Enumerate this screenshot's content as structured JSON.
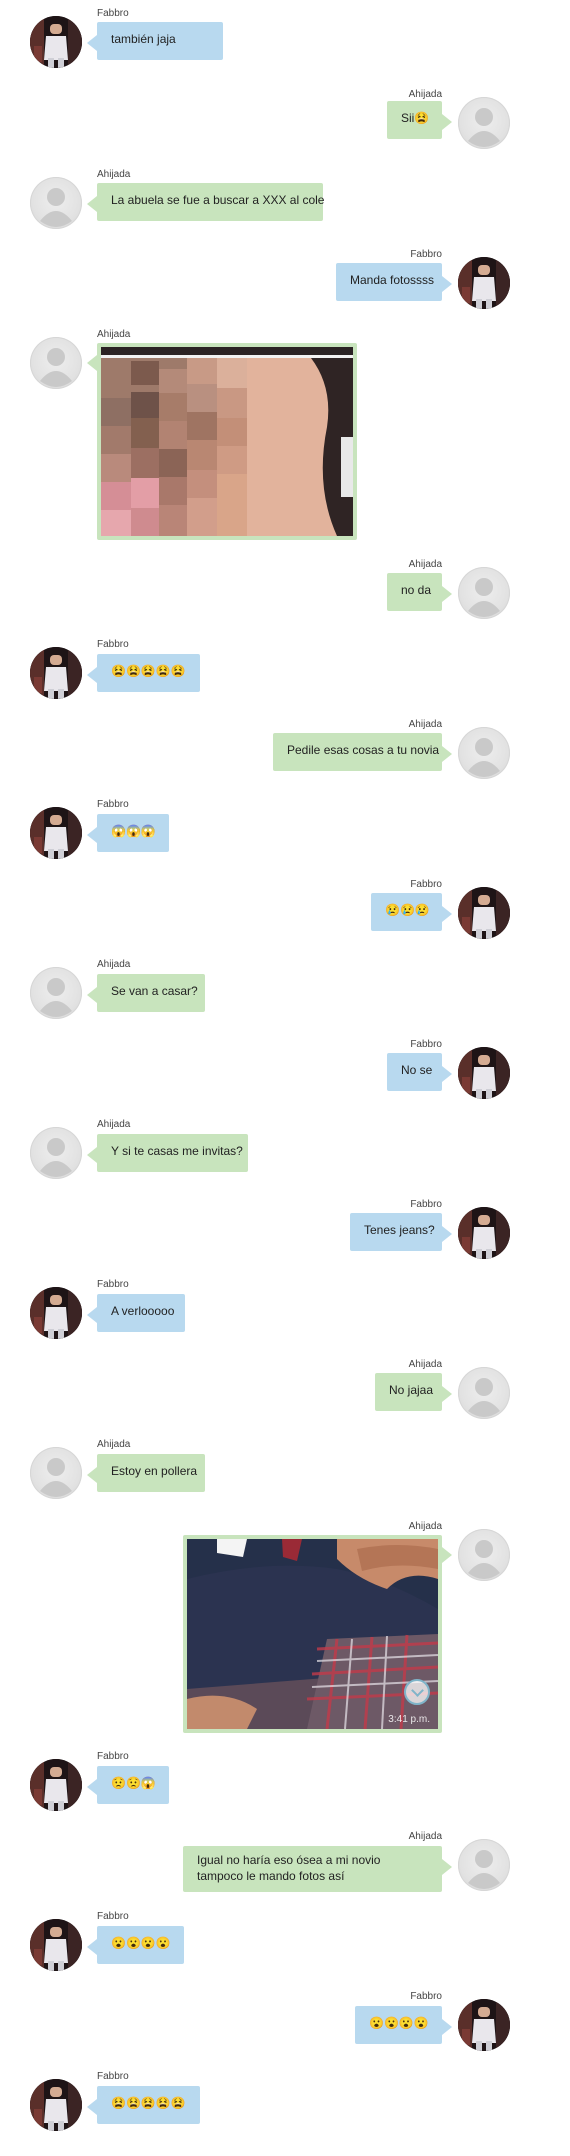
{
  "participants": {
    "fabbro": "Fabbro",
    "ahijada": "Ahijada"
  },
  "colors": {
    "fabbro_bubble": "#b8d9ef",
    "ahijada_bubble": "#c8e4bd",
    "background": "#ffffff"
  },
  "messages": [
    {
      "side": "left",
      "sender": "Fabbro",
      "text": "también jaja",
      "type": "text"
    },
    {
      "side": "right",
      "sender": "Ahijada",
      "text": "Sii😫",
      "type": "text"
    },
    {
      "side": "left",
      "sender": "Ahijada",
      "text": "La abuela se fue a buscar a XXX al cole",
      "type": "text"
    },
    {
      "side": "right",
      "sender": "Fabbro",
      "text": "Manda fotossss",
      "type": "text"
    },
    {
      "side": "left",
      "sender": "Ahijada",
      "text": "",
      "type": "image",
      "image": "pixelated-photo"
    },
    {
      "side": "right",
      "sender": "Ahijada",
      "text": "no da",
      "type": "text"
    },
    {
      "side": "left",
      "sender": "Fabbro",
      "text": "😫😫😫😫😫",
      "type": "text"
    },
    {
      "side": "right",
      "sender": "Ahijada",
      "text": "Pedile esas cosas a tu novia",
      "type": "text"
    },
    {
      "side": "left",
      "sender": "Fabbro",
      "text": "😱😱😱",
      "type": "text"
    },
    {
      "side": "right",
      "sender": "Fabbro",
      "text": "😢😢😢",
      "type": "text"
    },
    {
      "side": "left",
      "sender": "Ahijada",
      "text": "Se van a casar?",
      "type": "text"
    },
    {
      "side": "right",
      "sender": "Fabbro",
      "text": "No se",
      "type": "text"
    },
    {
      "side": "left",
      "sender": "Ahijada",
      "text": "Y si te casas me invitas?",
      "type": "text"
    },
    {
      "side": "right",
      "sender": "Fabbro",
      "text": "Tenes jeans?",
      "type": "text"
    },
    {
      "side": "left",
      "sender": "Fabbro",
      "text": "A verlooooo",
      "type": "text"
    },
    {
      "side": "right",
      "sender": "Ahijada",
      "text": "No jajaa",
      "type": "text"
    },
    {
      "side": "left",
      "sender": "Ahijada",
      "text": "Estoy en pollera",
      "type": "text"
    },
    {
      "side": "right",
      "sender": "Ahijada",
      "text": "",
      "type": "image",
      "image": "photo-plaid-skirt",
      "timestamp": "3:41 p.m."
    },
    {
      "side": "left",
      "sender": "Fabbro",
      "text": "😟😟😱",
      "type": "text"
    },
    {
      "side": "right",
      "sender": "Ahijada",
      "text": "Igual no haría eso ósea a mi novio tampoco le mando fotos así",
      "type": "text"
    },
    {
      "side": "left",
      "sender": "Fabbro",
      "text": "😮😮😮😮",
      "type": "text"
    },
    {
      "side": "right",
      "sender": "Fabbro",
      "text": "😮😮😮😮",
      "type": "text"
    },
    {
      "side": "left",
      "sender": "Fabbro",
      "text": "😫😫😫😫😫",
      "type": "text"
    }
  ]
}
